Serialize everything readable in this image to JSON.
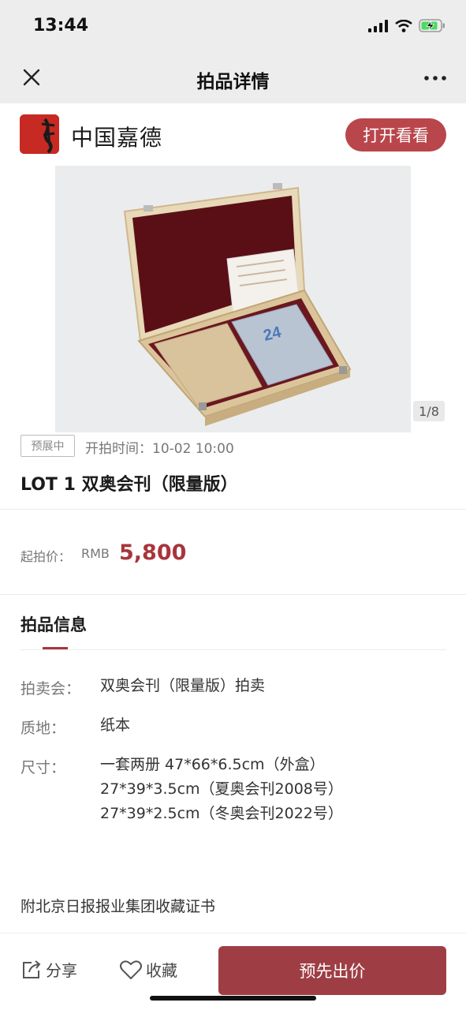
{
  "status_bar": {
    "time": "13:44"
  },
  "nav": {
    "title": "拍品详情",
    "close_icon": "close-icon",
    "more_icon": "more-icon"
  },
  "brand": {
    "name": "中国嘉德",
    "open_button": "打开看看",
    "accent": "#c62a22"
  },
  "gallery": {
    "counter": "1/8",
    "current": 1,
    "total": 8
  },
  "lot": {
    "status_tag": "预展中",
    "start_time": "开拍时间：10-02 10:00",
    "title": "LOT 1 双奥会刊（限量版）"
  },
  "price": {
    "label": "起拍价：",
    "currency": "RMB",
    "value": "5,800",
    "color": "#a8353b"
  },
  "details": {
    "section_title": "拍品信息",
    "rows": [
      {
        "key": "拍卖会：",
        "value": "双奥会刊（限量版）拍卖"
      },
      {
        "key": "质地：",
        "value": "纸本"
      },
      {
        "key": "尺寸：",
        "lines": [
          "一套两册 47*66*6.5cm（外盒）",
          "27*39*3.5cm（夏奥会刊2008号）",
          "27*39*2.5cm（冬奥会刊2022号）"
        ]
      }
    ],
    "note": "附北京日报报业集团收藏证书"
  },
  "bottom": {
    "share_label": "分享",
    "favorite_label": "收藏",
    "bid_button": "预先出价",
    "bid_color": "#9e3e44"
  }
}
